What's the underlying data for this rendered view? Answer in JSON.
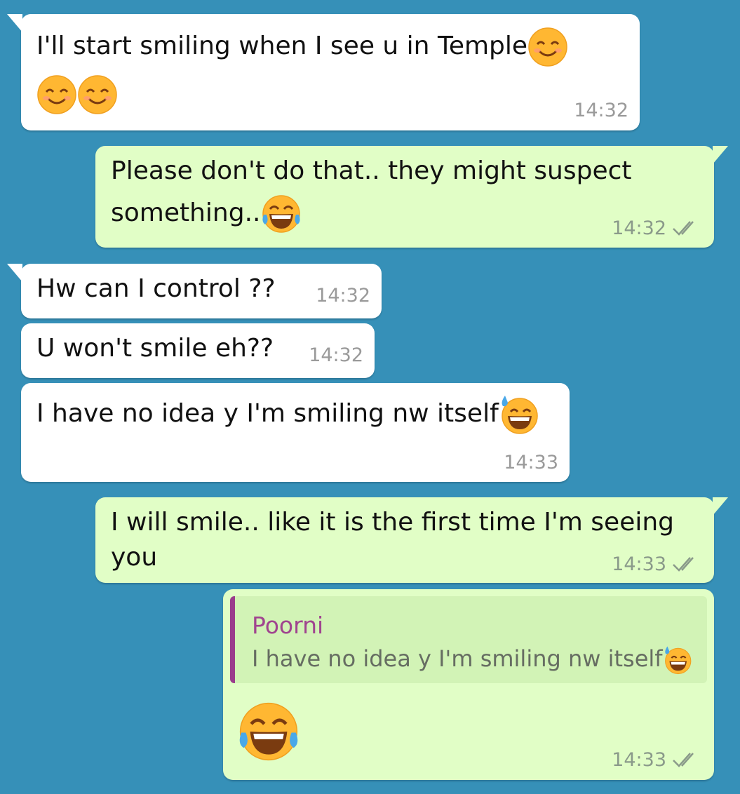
{
  "chat": {
    "messages": [
      {
        "direction": "in",
        "text_line1": "I'll start smiling when I see u in Temple",
        "time": "14:32",
        "emojis_line1": [
          "smiling-face-icon"
        ],
        "emojis_line2": [
          "smiling-face-icon",
          "smiling-face-icon"
        ]
      },
      {
        "direction": "out",
        "text_line1": "Please don't do that.. they might suspect",
        "text_line2": "something..",
        "time": "14:32",
        "status": "read",
        "emojis_line2": [
          "tears-of-joy-icon"
        ]
      },
      {
        "direction": "in",
        "text_line1": "Hw can I control ??",
        "time": "14:32"
      },
      {
        "direction": "in",
        "text_line1": "U won't smile eh??",
        "time": "14:32"
      },
      {
        "direction": "in",
        "text_line1": "I have no idea y I'm smiling nw itself",
        "time": "14:33",
        "emojis_line1": [
          "grinning-sweat-icon"
        ]
      },
      {
        "direction": "out",
        "text_line1": "I will smile.. like it is the first time I'm seeing",
        "text_line2": "you",
        "time": "14:33",
        "status": "read"
      },
      {
        "direction": "out",
        "quote": {
          "author": "Poorni",
          "text": "I have no idea y I'm smiling nw itself",
          "emoji": "grinning-sweat-icon"
        },
        "big_emoji": "tears-of-joy-icon",
        "time": "14:33",
        "status": "read"
      }
    ]
  },
  "colors": {
    "background": "#3690b8",
    "incoming_bubble": "#ffffff",
    "outgoing_bubble": "#e1fec6",
    "quote_bar": "#9a3c8c",
    "quote_author": "#a0448f"
  }
}
